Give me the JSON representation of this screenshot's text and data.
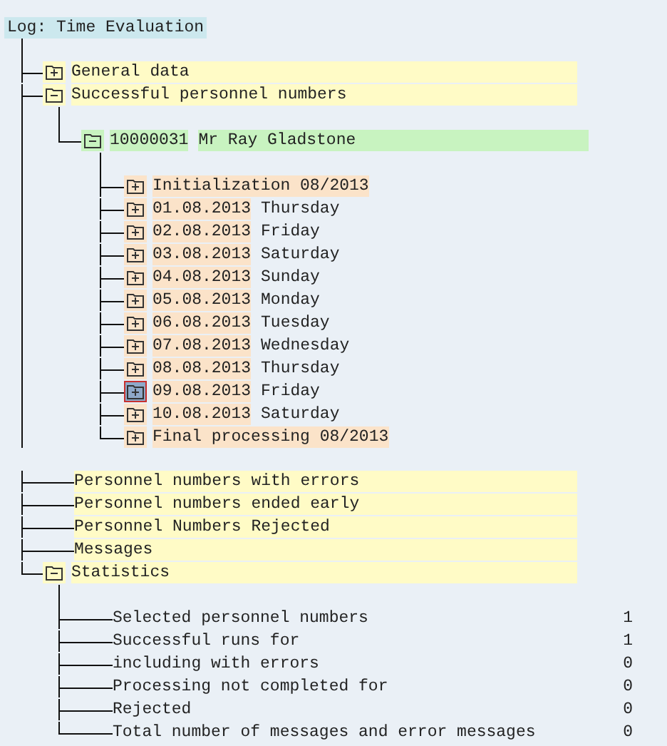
{
  "log_title": "Log: Time Evaluation",
  "tree": [
    {
      "kind": "folder",
      "label": "General data",
      "expanded": false
    },
    {
      "kind": "folder",
      "label": "Successful personnel numbers",
      "expanded": true,
      "children": [
        {
          "kind": "folder",
          "label": "10000031",
          "detail": "Mr Ray Gladstone",
          "expanded": true,
          "children": [
            {
              "kind": "folder",
              "label": "Initialization 08/2013",
              "expanded": false,
              "selected": false
            },
            {
              "kind": "folder",
              "label": "01.08.2013",
              "detail": "Thursday",
              "expanded": false,
              "selected": false
            },
            {
              "kind": "folder",
              "label": "02.08.2013",
              "detail": "Friday",
              "expanded": false,
              "selected": false
            },
            {
              "kind": "folder",
              "label": "03.08.2013",
              "detail": "Saturday",
              "expanded": false,
              "selected": false
            },
            {
              "kind": "folder",
              "label": "04.08.2013",
              "detail": "Sunday",
              "expanded": false,
              "selected": false
            },
            {
              "kind": "folder",
              "label": "05.08.2013",
              "detail": "Monday",
              "expanded": false,
              "selected": false
            },
            {
              "kind": "folder",
              "label": "06.08.2013",
              "detail": "Tuesday",
              "expanded": false,
              "selected": false
            },
            {
              "kind": "folder",
              "label": "07.08.2013",
              "detail": "Wednesday",
              "expanded": false,
              "selected": false
            },
            {
              "kind": "folder",
              "label": "08.08.2013",
              "detail": "Thursday",
              "expanded": false,
              "selected": false
            },
            {
              "kind": "folder",
              "label": "09.08.2013",
              "detail": "Friday",
              "expanded": false,
              "selected": true
            },
            {
              "kind": "folder",
              "label": "10.08.2013",
              "detail": "Saturday",
              "expanded": false,
              "selected": false
            },
            {
              "kind": "folder",
              "label": "Final processing 08/2013",
              "expanded": false,
              "selected": false
            }
          ]
        }
      ]
    },
    {
      "kind": "text",
      "label": "Personnel numbers with errors"
    },
    {
      "kind": "text",
      "label": "Personnel numbers ended early"
    },
    {
      "kind": "text",
      "label": "Personnel Numbers Rejected"
    },
    {
      "kind": "text",
      "label": "Messages"
    },
    {
      "kind": "folder",
      "label": "Statistics",
      "expanded": true,
      "children": [
        {
          "kind": "stat",
          "label": "Selected personnel numbers",
          "value": "1"
        },
        {
          "kind": "stat",
          "label": "Successful runs for",
          "value": "1"
        },
        {
          "kind": "stat",
          "label": "including with errors",
          "value": "0"
        },
        {
          "kind": "stat",
          "label": "Processing not completed for",
          "value": "0"
        },
        {
          "kind": "stat",
          "label": "Rejected",
          "value": "0"
        },
        {
          "kind": "stat",
          "label": "Total number of messages and error messages",
          "value": "0"
        }
      ]
    }
  ]
}
